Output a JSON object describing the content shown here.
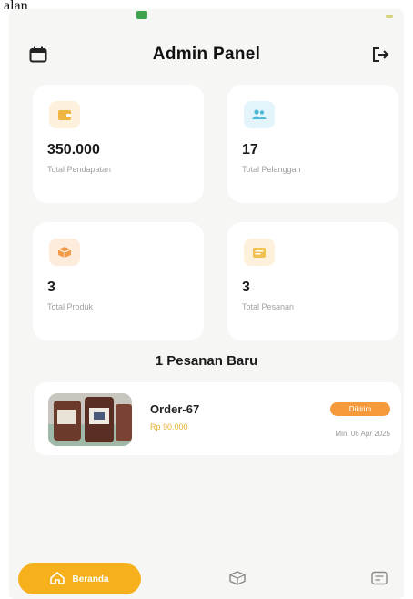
{
  "top_fragment": "alan",
  "header": {
    "title": "Admin Panel",
    "calendar_icon": "calendar-icon",
    "logout_icon": "logout-icon"
  },
  "stats": [
    {
      "value": "350.000",
      "label": "Total Pendapatan",
      "icon": "wallet-icon",
      "icon_bg": "#fdf1dc",
      "icon_color": "#f0b440"
    },
    {
      "value": "17",
      "label": "Total Pelanggan",
      "icon": "users-icon",
      "icon_bg": "#e3f5fb",
      "icon_color": "#4cb8d6"
    },
    {
      "value": "3",
      "label": "Total Produk",
      "icon": "box-icon",
      "icon_bg": "#fdebdc",
      "icon_color": "#f09a4a"
    },
    {
      "value": "3",
      "label": "Total Pesanan",
      "icon": "receipt-icon",
      "icon_bg": "#fdf1dc",
      "icon_color": "#f0c050"
    }
  ],
  "new_orders": {
    "title": "1 Pesanan Baru",
    "items": [
      {
        "id": "Order-67",
        "price": "Rp 90.000",
        "status": "Dikirim",
        "date": "Min, 06 Apr 2025"
      }
    ]
  },
  "bottom_nav": {
    "home_label": "Beranda",
    "home_icon": "home-icon",
    "product_icon": "box-icon",
    "orders_icon": "receipt-icon"
  },
  "colors": {
    "accent": "#f5b01c",
    "status_badge": "#f59a3a",
    "price": "#e8b030",
    "background": "#f6f6f4"
  }
}
